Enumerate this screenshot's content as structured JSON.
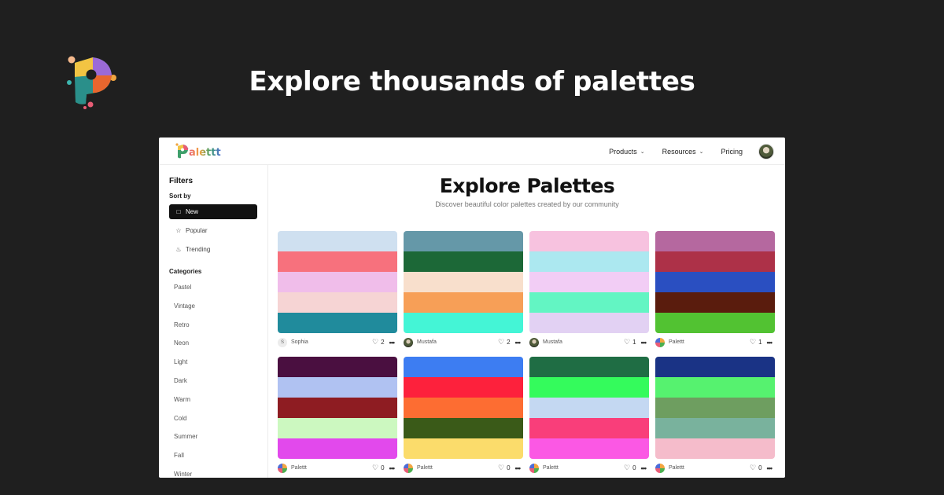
{
  "hero": {
    "title": "Explore thousands of palettes"
  },
  "header": {
    "brand": "alettt",
    "nav": [
      {
        "label": "Products",
        "has_dropdown": true
      },
      {
        "label": "Resources",
        "has_dropdown": true
      },
      {
        "label": "Pricing",
        "has_dropdown": false
      }
    ]
  },
  "sidebar": {
    "title": "Filters",
    "sort_label": "Sort by",
    "sort_options": [
      {
        "label": "New",
        "icon": "calendar-icon",
        "active": true
      },
      {
        "label": "Popular",
        "icon": "star-icon",
        "active": false
      },
      {
        "label": "Trending",
        "icon": "flame-icon",
        "active": false
      }
    ],
    "categories_label": "Categories",
    "categories": [
      "Pastel",
      "Vintage",
      "Retro",
      "Neon",
      "Light",
      "Dark",
      "Warm",
      "Cold",
      "Summer",
      "Fall",
      "Winter"
    ]
  },
  "main": {
    "title": "Explore Palettes",
    "subtitle": "Discover beautiful color palettes created by our community"
  },
  "palettes": [
    {
      "colors": [
        "#cfe0f0",
        "#f7717d",
        "#f0bdea",
        "#f6d4d4",
        "#208b9c"
      ],
      "author": "Sophia",
      "avatar": "letter",
      "initial": "S",
      "likes": "2"
    },
    {
      "colors": [
        "#6598a8",
        "#1c6837",
        "#f8dfcc",
        "#f79f57",
        "#44f5d6"
      ],
      "author": "Mustafa",
      "avatar": "photo",
      "initial": "",
      "likes": "2"
    },
    {
      "colors": [
        "#f7c2df",
        "#ace8f0",
        "#f2cdf5",
        "#63f5c3",
        "#e2d1f3"
      ],
      "author": "Mustafa",
      "avatar": "photo",
      "initial": "",
      "likes": "1"
    },
    {
      "colors": [
        "#b5689f",
        "#ad3148",
        "#2a4fc1",
        "#5a1c0d",
        "#52c232"
      ],
      "author": "Palettt",
      "avatar": "logo",
      "initial": "",
      "likes": "1"
    },
    {
      "colors": [
        "#4a0f40",
        "#b0c2f2",
        "#8e1c22",
        "#ccf8c0",
        "#e249ec"
      ],
      "author": "Palettt",
      "avatar": "logo",
      "initial": "",
      "likes": "0"
    },
    {
      "colors": [
        "#3d7df2",
        "#fd213c",
        "#fd6d32",
        "#3a5a18",
        "#fbdc6b"
      ],
      "author": "Palettt",
      "avatar": "logo",
      "initial": "",
      "likes": "0"
    },
    {
      "colors": [
        "#1f6d44",
        "#34fb5c",
        "#c4d8f2",
        "#f93e7a",
        "#fb58e4"
      ],
      "author": "Palettt",
      "avatar": "logo",
      "initial": "",
      "likes": "0"
    },
    {
      "colors": [
        "#1a3385",
        "#56f26f",
        "#6e9e60",
        "#79b29d",
        "#f5bccb"
      ],
      "author": "Palettt",
      "avatar": "logo",
      "initial": "",
      "likes": "0"
    }
  ]
}
